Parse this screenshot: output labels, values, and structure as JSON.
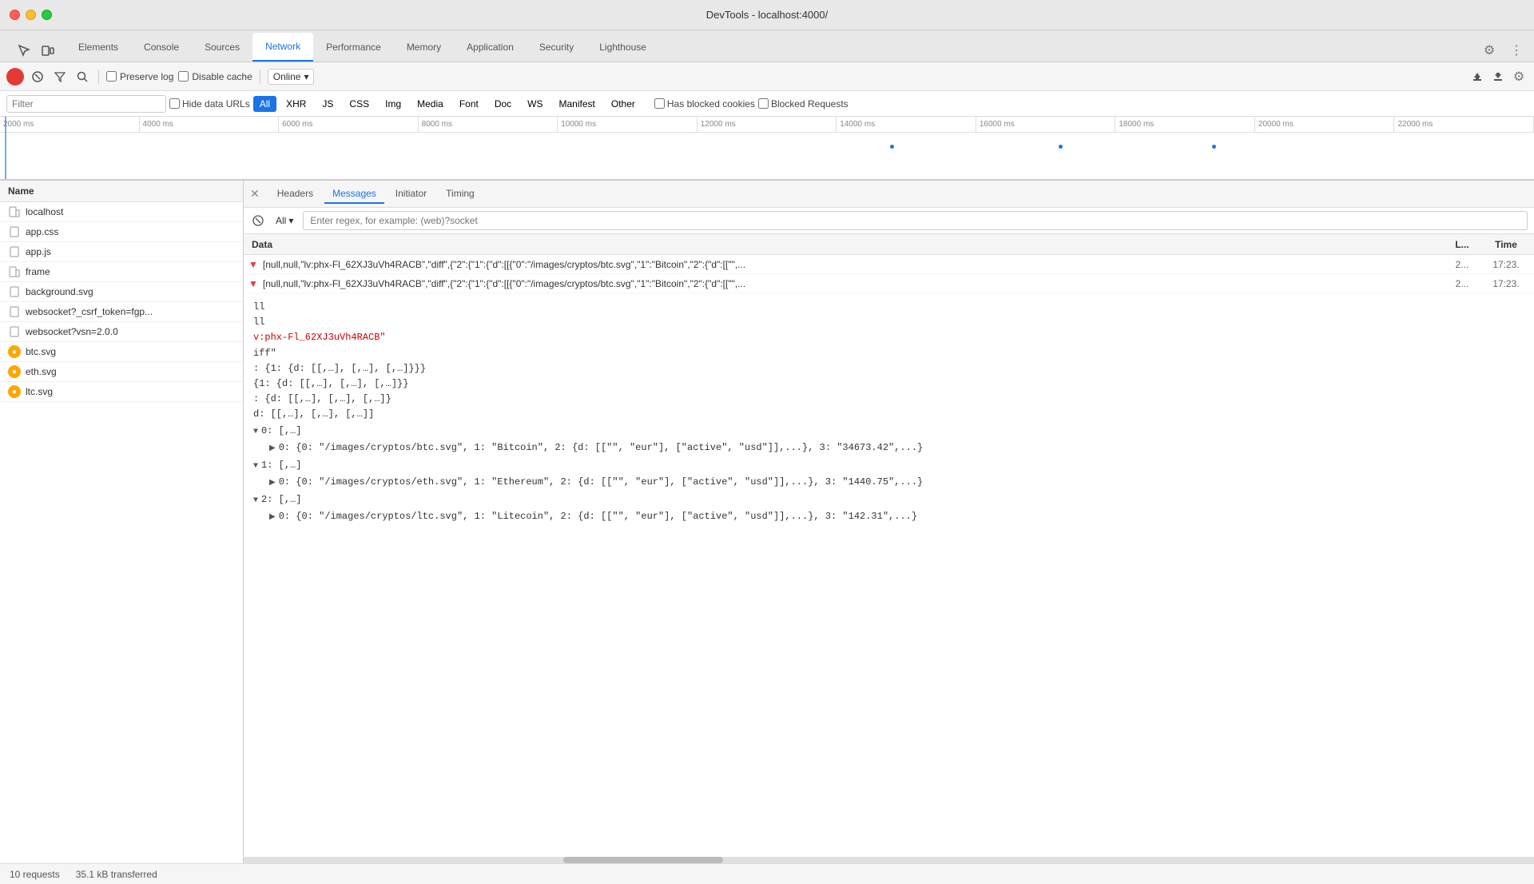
{
  "titleBar": {
    "title": "DevTools - localhost:4000/"
  },
  "topTabs": [
    {
      "label": "Elements",
      "active": false
    },
    {
      "label": "Console",
      "active": false
    },
    {
      "label": "Sources",
      "active": false
    },
    {
      "label": "Network",
      "active": true
    },
    {
      "label": "Performance",
      "active": false
    },
    {
      "label": "Memory",
      "active": false
    },
    {
      "label": "Application",
      "active": false
    },
    {
      "label": "Security",
      "active": false
    },
    {
      "label": "Lighthouse",
      "active": false
    }
  ],
  "toolbar": {
    "preserveLog": "Preserve log",
    "disableCache": "Disable cache",
    "onlineLabel": "Online"
  },
  "filterBar": {
    "filterPlaceholder": "Filter",
    "hideDataUrls": "Hide data URLs",
    "filterTypes": [
      "All",
      "XHR",
      "JS",
      "CSS",
      "Img",
      "Media",
      "Font",
      "Doc",
      "WS",
      "Manifest",
      "Other"
    ],
    "activeFilter": "All",
    "hasBlockedCookies": "Has blocked cookies",
    "blockedRequests": "Blocked Requests"
  },
  "timeline": {
    "ticks": [
      "2000 ms",
      "4000 ms",
      "6000 ms",
      "8000 ms",
      "10000 ms",
      "12000 ms",
      "14000 ms",
      "16000 ms",
      "18000 ms",
      "20000 ms",
      "22000 ms"
    ]
  },
  "leftPanel": {
    "header": "Name",
    "files": [
      {
        "name": "localhost",
        "type": "file"
      },
      {
        "name": "app.css",
        "type": "file"
      },
      {
        "name": "app.js",
        "type": "file"
      },
      {
        "name": "frame",
        "type": "file"
      },
      {
        "name": "background.svg",
        "type": "file"
      },
      {
        "name": "websocket?_csrf_token=fgp...",
        "type": "ws"
      },
      {
        "name": "websocket?vsn=2.0.0",
        "type": "ws"
      },
      {
        "name": "btc.svg",
        "type": "img"
      },
      {
        "name": "eth.svg",
        "type": "img"
      },
      {
        "name": "ltc.svg",
        "type": "img"
      }
    ]
  },
  "detailTabs": [
    {
      "label": "Headers",
      "active": false
    },
    {
      "label": "Messages",
      "active": true
    },
    {
      "label": "Initiator",
      "active": false
    },
    {
      "label": "Timing",
      "active": false
    }
  ],
  "messagesPanel": {
    "filterLabel": "All",
    "filterPlaceholder": "Enter regex, for example: (web)?socket"
  },
  "dataTable": {
    "header": {
      "data": "Data",
      "length": "L...",
      "time": "Time"
    },
    "rows": [
      {
        "text": "[null,null,\"lv:phx-Fl_62XJ3uVh4RACB\",\"diff\",{\"2\":{\"1\":{\"d\":[[{\"0\":\"/images/cryptos/btc.svg\",\"1\":\"Bitcoin\",\"2\":{\"d\":[[\"\",...",
        "length": "2...",
        "time": "17:23."
      },
      {
        "text": "[null,null,\"lv:phx-Fl_62XJ3uVh4RACB\",\"diff\",{\"2\":{\"1\":{\"d\":[[{\"0\":\"/images/cryptos/btc.svg\",\"1\":\"Bitcoin\",\"2\":{\"d\":[[\"\",...",
        "length": "2...",
        "time": "17:23."
      }
    ]
  },
  "messageContent": {
    "lines": [
      {
        "text": "ll",
        "style": "normal"
      },
      {
        "text": "ll",
        "style": "normal"
      },
      {
        "text": "v:phx-Fl_62XJ3uVh4RACB\"",
        "style": "red"
      },
      {
        "text": "iff\"",
        "style": "normal"
      },
      {
        "text": ": {1: {d: [[,…], [,…], [,…]}}}",
        "style": "normal"
      },
      {
        "text": "{1: {d: [[,…], [,…], [,…]}}",
        "style": "normal"
      },
      {
        "text": ": {d: [[,…], [,…], [,…]}",
        "style": "normal"
      },
      {
        "text": "d: [[,…], [,…], [,…]]",
        "style": "normal"
      }
    ],
    "treeData": {
      "item0": {
        "label": "▼ 0: [,…]",
        "indent": 0,
        "children": [
          "▶ 0: {0: \"/images/cryptos/btc.svg\", 1: \"Bitcoin\", 2: {d: [[\"\"  , \"eur\"], [\"active\" , \"usd\"]],...}, 3: \"34673.42\",...}"
        ]
      },
      "item1": {
        "label": "▼ 1: [,…]",
        "indent": 0,
        "children": [
          "▶ 0: {0: \"/images/cryptos/eth.svg\", 1: \"Ethereum\", 2: {d: [[\"\" , \"eur\"], [\"active\" , \"usd\"]],...}, 3: \"1440.75\",...}"
        ]
      },
      "item2": {
        "label": "▼ 2: [,…]",
        "indent": 0,
        "children": [
          "▶ 0: {0: \"/images/cryptos/ltc.svg\", 1: \"Litecoin\", 2: {d: [[\"\" , \"eur\"], [\"active\" , \"usd\"]],...}, 3: \"142.31\",...}"
        ]
      }
    }
  },
  "statusBar": {
    "requests": "10 requests",
    "transferred": "35.1 kB transferred"
  }
}
